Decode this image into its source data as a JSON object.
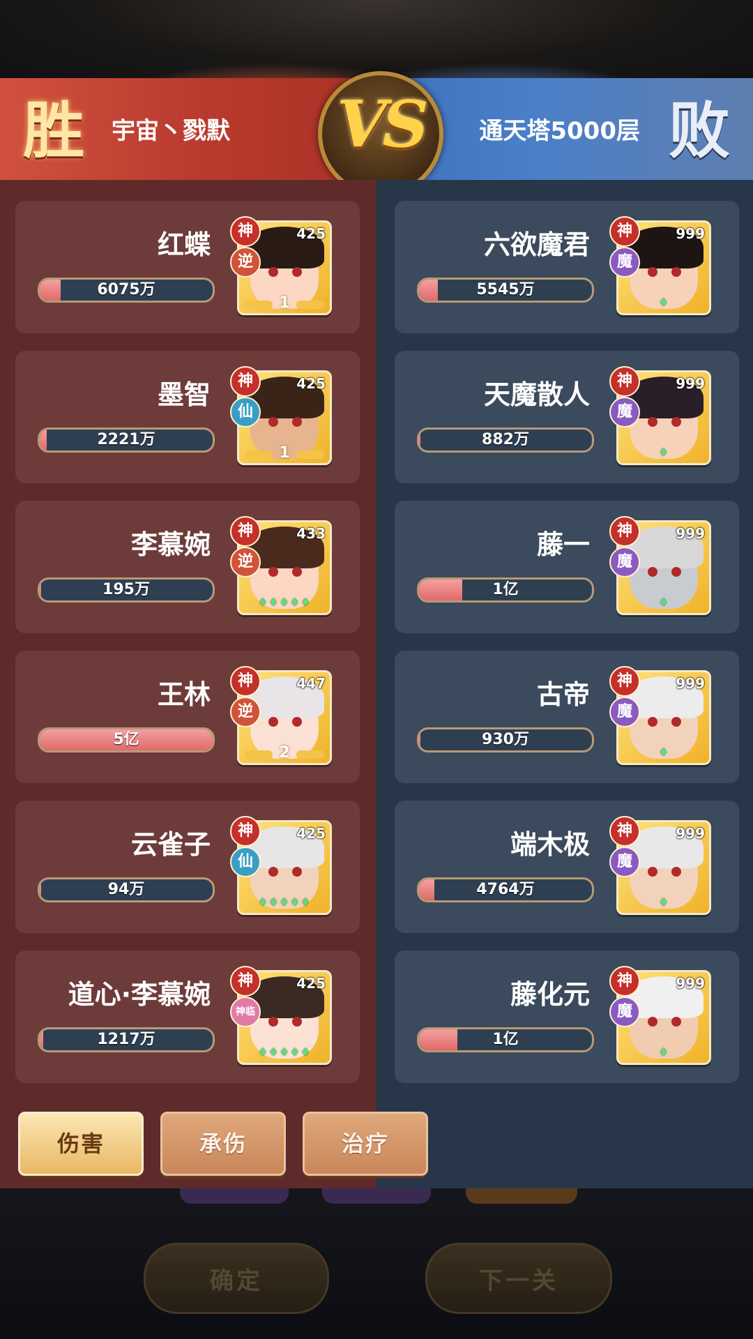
{
  "header": {
    "win_label": "胜",
    "lose_label": "败",
    "left_team": "宇宙丶戮默",
    "right_team": "通天塔5000层",
    "vs_label": "VS"
  },
  "left_heroes": [
    {
      "name": "红蝶",
      "value": "6075万",
      "fill": 0.12,
      "level": "425",
      "faction": "逆",
      "rank": "1"
    },
    {
      "name": "墨智",
      "value": "2221万",
      "fill": 0.04,
      "level": "425",
      "faction": "仙",
      "rank": "1"
    },
    {
      "name": "李慕婉",
      "value": "195万",
      "fill": 0.0,
      "level": "433",
      "faction": "逆",
      "stars": "♦♦♦♦♦"
    },
    {
      "name": "王林",
      "value": "5亿",
      "fill": 1.0,
      "level": "447",
      "faction": "逆",
      "rank": "2"
    },
    {
      "name": "云雀子",
      "value": "94万",
      "fill": 0.0,
      "level": "425",
      "faction": "仙",
      "stars": "♦♦♦♦♦"
    },
    {
      "name": "道心·李慕婉",
      "value": "1217万",
      "fill": 0.02,
      "level": "425",
      "faction": "神临",
      "stars": "♦♦♦♦♦"
    }
  ],
  "right_heroes": [
    {
      "name": "六欲魔君",
      "value": "5545万",
      "fill": 0.11,
      "level": "999",
      "faction": "魔",
      "stars": "♦"
    },
    {
      "name": "天魔散人",
      "value": "882万",
      "fill": 0.0,
      "level": "999",
      "faction": "魔",
      "stars": "♦"
    },
    {
      "name": "藤一",
      "value": "1亿",
      "fill": 0.25,
      "level": "999",
      "faction": "魔",
      "stars": "♦"
    },
    {
      "name": "古帝",
      "value": "930万",
      "fill": 0.0,
      "level": "999",
      "faction": "魔",
      "stars": "♦"
    },
    {
      "name": "端木极",
      "value": "4764万",
      "fill": 0.09,
      "level": "999",
      "faction": "魔",
      "stars": "♦"
    },
    {
      "name": "藤化元",
      "value": "1亿",
      "fill": 0.22,
      "level": "999",
      "faction": "魔",
      "stars": "♦"
    }
  ],
  "badge_shen": "神",
  "tabs": [
    {
      "label": "伤害",
      "active": true
    },
    {
      "label": "承伤",
      "active": false
    },
    {
      "label": "治疗",
      "active": false
    }
  ],
  "bottom_buttons": {
    "confirm": "确定",
    "next": "下一关"
  },
  "colors": {
    "win_red": "#b83a2d",
    "lose_blue": "#4a7fc8",
    "bar_fill": "#e06a6a",
    "gold": "#ffd24a"
  }
}
